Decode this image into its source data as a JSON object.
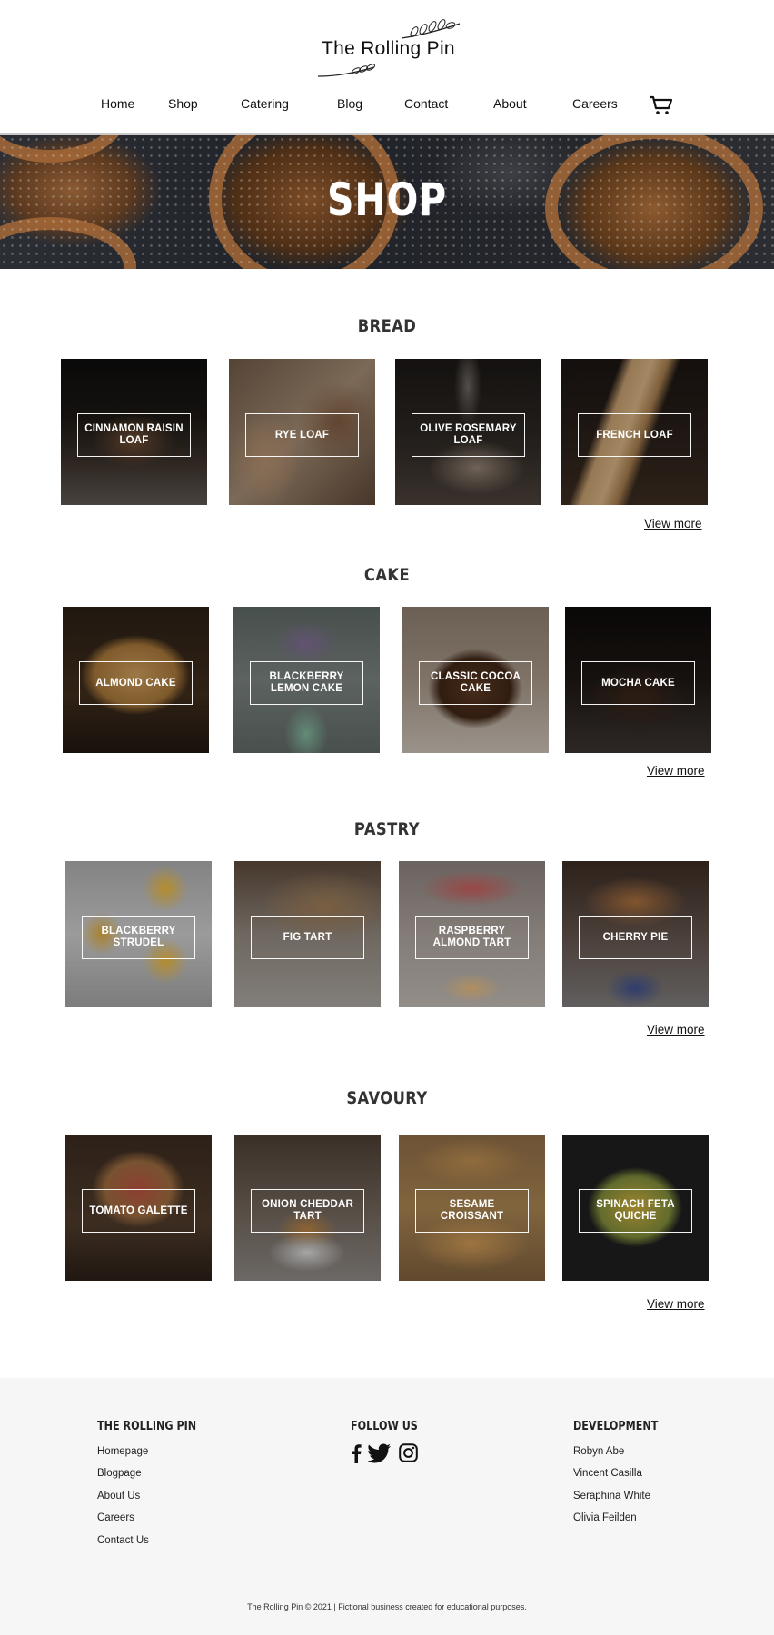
{
  "site": {
    "logo_text": "The Rolling Pin"
  },
  "nav": {
    "items": [
      "Home",
      "Shop",
      "Catering",
      "Blog",
      "Contact",
      "About",
      "Careers"
    ],
    "cart_icon": "cart-icon"
  },
  "hero": {
    "title": "SHOP"
  },
  "sections": [
    {
      "title": "BREAD",
      "items": [
        "CINNAMON RAISIN LOAF",
        "RYE LOAF",
        "OLIVE ROSEMARY LOAF",
        "FRENCH LOAF"
      ],
      "view_more": "View more"
    },
    {
      "title": "CAKE",
      "items": [
        "ALMOND CAKE",
        "BLACKBERRY LEMON CAKE",
        "CLASSIC COCOA CAKE",
        "MOCHA CAKE"
      ],
      "view_more": "View more"
    },
    {
      "title": "PASTRY",
      "items": [
        "BLACKBERRY STRUDEL",
        "FIG TART",
        "RASPBERRY ALMOND TART",
        "CHERRY PIE"
      ],
      "view_more": "View more"
    },
    {
      "title": "SAVOURY",
      "items": [
        "TOMATO GALETTE",
        "ONION CHEDDAR TART",
        "SESAME CROISSANT",
        "SPINACH FETA QUICHE"
      ],
      "view_more": "View more"
    }
  ],
  "footer": {
    "col1": {
      "title": "THE ROLLING PIN",
      "links": [
        "Homepage",
        "Blogpage",
        "About Us",
        "Careers",
        "Contact Us"
      ]
    },
    "col2": {
      "title": "FOLLOW US",
      "icons": [
        "facebook-icon",
        "twitter-icon",
        "instagram-icon"
      ]
    },
    "col3": {
      "title": "DEVELOPMENT",
      "names": [
        "Robyn Abe",
        "Vincent Casilla",
        "Seraphina White",
        "Olivia Feilden"
      ]
    },
    "copyright": "The Rolling Pin © 2021 | Fictional business created for educational purposes."
  }
}
